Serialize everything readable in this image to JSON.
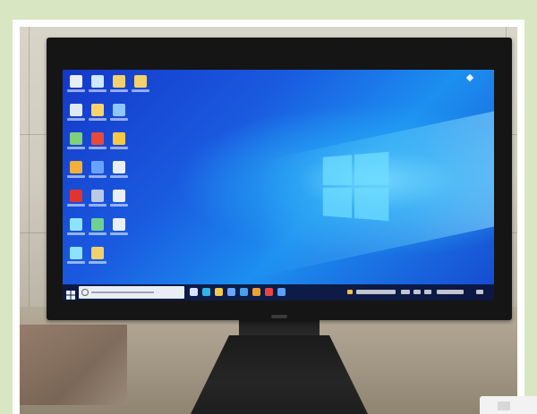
{
  "scene": {
    "subject": "",
    "background_color": "#d9e6c2"
  },
  "colors": {
    "bezel": "#151515",
    "desktop_accent": "#1c8ff0",
    "taskbar": "#0c1437"
  },
  "desktop": {
    "icons": [
      {
        "name": "this-pc-icon",
        "color": "#e8eef6"
      },
      {
        "name": "chat-icon",
        "color": "#cfe7ff"
      },
      {
        "name": "folder-icon",
        "color": "#f2d06b"
      },
      {
        "name": "folder-icon",
        "color": "#f2d06b"
      },
      {
        "name": "recycle-bin-icon",
        "color": "#dfe9f3"
      },
      {
        "name": "shortcut-icon",
        "color": "#ffd36a"
      },
      {
        "name": "app-shortcut-icon",
        "color": "#8fc6ff"
      },
      {
        "name": "blank",
        "color": ""
      },
      {
        "name": "network-icon",
        "color": "#7fd07a"
      },
      {
        "name": "pdf-app-icon",
        "color": "#e84a3a"
      },
      {
        "name": "app-shortcut-icon",
        "color": "#f6c844"
      },
      {
        "name": "blank",
        "color": ""
      },
      {
        "name": "browser-icon",
        "color": "#f0b03a"
      },
      {
        "name": "editor-icon",
        "color": "#6aa2ff"
      },
      {
        "name": "document-icon",
        "color": "#e9eef8"
      },
      {
        "name": "blank",
        "color": ""
      },
      {
        "name": "acrobat-icon",
        "color": "#e0352e"
      },
      {
        "name": "settings-icon",
        "color": "#b9c9e6"
      },
      {
        "name": "document-icon",
        "color": "#e9eef8"
      },
      {
        "name": "blank",
        "color": ""
      },
      {
        "name": "app-shortcut-icon",
        "color": "#8de3ff"
      },
      {
        "name": "map-icon",
        "color": "#70d090"
      },
      {
        "name": "document-icon",
        "color": "#e9eef8"
      },
      {
        "name": "blank",
        "color": ""
      },
      {
        "name": "app-shortcut-icon",
        "color": "#8de3ff"
      },
      {
        "name": "folder-icon",
        "color": "#f2d06b"
      }
    ]
  },
  "taskbar": {
    "search_placeholder": "",
    "pinned_apps": [
      {
        "name": "task-view-icon",
        "color": "#d6e2ff"
      },
      {
        "name": "edge-icon",
        "color": "#2fb6e8"
      },
      {
        "name": "explorer-icon",
        "color": "#f3c94a"
      },
      {
        "name": "store-icon",
        "color": "#6aa6ff"
      },
      {
        "name": "mail-icon",
        "color": "#4aa0f0"
      },
      {
        "name": "browser-icon",
        "color": "#f0a030"
      },
      {
        "name": "app-icon",
        "color": "#e84545"
      },
      {
        "name": "app-icon",
        "color": "#5aa0ff"
      }
    ]
  }
}
